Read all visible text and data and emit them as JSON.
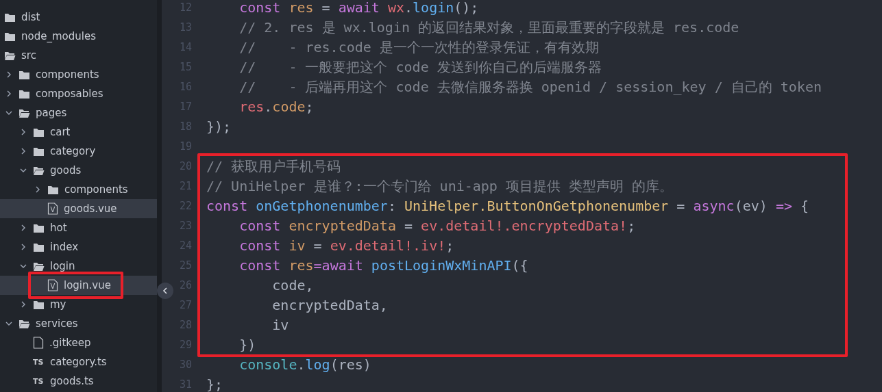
{
  "explorer": {
    "items": [
      {
        "name": "dist",
        "kind": "folder"
      },
      {
        "name": "node_modules",
        "kind": "folder"
      },
      {
        "name": "src",
        "kind": "folder",
        "children": [
          {
            "name": "components",
            "kind": "folder",
            "expanded": false,
            "selected": false
          },
          {
            "name": "composables",
            "kind": "folder",
            "expanded": false,
            "selected": false
          },
          {
            "name": "pages",
            "kind": "folder",
            "expanded": true,
            "selected": false,
            "children": [
              {
                "name": "cart",
                "kind": "folder",
                "expanded": false,
                "selected": false
              },
              {
                "name": "category",
                "kind": "folder",
                "expanded": false,
                "selected": false
              },
              {
                "name": "goods",
                "kind": "folder",
                "expanded": true,
                "selected": false,
                "children": [
                  {
                    "name": "components",
                    "kind": "folder",
                    "expanded": false,
                    "selected": false
                  },
                  {
                    "name": "goods.vue",
                    "kind": "vue",
                    "badge": "V",
                    "selected": true
                  }
                ]
              },
              {
                "name": "hot",
                "kind": "folder",
                "expanded": false,
                "selected": false
              },
              {
                "name": "index",
                "kind": "folder",
                "expanded": false,
                "selected": false
              },
              {
                "name": "login",
                "kind": "folder",
                "expanded": true,
                "selected": false,
                "children": [
                  {
                    "name": "login.vue",
                    "kind": "vue",
                    "badge": "V",
                    "selected": true,
                    "highlighted": true
                  }
                ]
              },
              {
                "name": "my",
                "kind": "folder",
                "expanded": false,
                "selected": false
              }
            ]
          },
          {
            "name": "services",
            "kind": "folder",
            "expanded": true,
            "selected": false,
            "children": [
              {
                "name": ".gitkeep",
                "kind": "file",
                "selected": false
              },
              {
                "name": "category.ts",
                "kind": "ts",
                "badge": "TS",
                "selected": false
              },
              {
                "name": "goods.ts",
                "kind": "ts",
                "badge": "TS",
                "selected": false
              }
            ]
          }
        ]
      }
    ]
  },
  "editor": {
    "blocks": [
      {
        "highlighted": false,
        "lines": [
          {
            "number": "12",
            "tokens": [
              {
                "kind": "kw",
                "t": "    const "
              },
              {
                "kind": "var",
                "t": "res"
              },
              {
                "kind": "plain",
                "t": " = "
              },
              {
                "kind": "kw",
                "t": "await "
              },
              {
                "kind": "obj",
                "t": "wx"
              },
              {
                "kind": "plain",
                "t": "."
              },
              {
                "kind": "fn",
                "t": "login"
              },
              {
                "kind": "plain",
                "t": "();"
              }
            ]
          },
          {
            "number": "13",
            "tokens": [
              {
                "kind": "comment",
                "t": "    // 2. res 是 wx.login 的返回结果对象，里面最重要的字段就是 res.code"
              }
            ]
          },
          {
            "number": "14",
            "tokens": [
              {
                "kind": "comment",
                "t": "    //    - res.code 是一个一次性的登录凭证，有有效期"
              }
            ]
          },
          {
            "number": "15",
            "tokens": [
              {
                "kind": "comment",
                "t": "    //    - 一般要把这个 code 发送到你自己的后端服务器"
              }
            ]
          },
          {
            "number": "16",
            "tokens": [
              {
                "kind": "comment",
                "t": "    //    - 后端再用这个 code 去微信服务器换 openid / session_key / 自己的 token"
              }
            ]
          },
          {
            "number": "17",
            "tokens": [
              {
                "kind": "obj",
                "t": "    res"
              },
              {
                "kind": "plain",
                "t": "."
              },
              {
                "kind": "prop",
                "t": "code"
              },
              {
                "kind": "plain",
                "t": ";"
              }
            ]
          },
          {
            "number": "18",
            "tokens": [
              {
                "kind": "plain",
                "t": "});"
              }
            ]
          },
          {
            "number": "19"
          }
        ]
      },
      {
        "highlighted": true,
        "lines": [
          {
            "number": "20",
            "tokens": [
              {
                "kind": "comment",
                "t": "// 获取用户手机号码"
              }
            ]
          },
          {
            "number": "21",
            "tokens": [
              {
                "kind": "comment",
                "t": "// UniHelper 是谁？:一个专门给 uni-app 项目提供 类型声明 的库。"
              }
            ]
          },
          {
            "number": "22",
            "tokens": [
              {
                "kind": "kw",
                "t": "const "
              },
              {
                "kind": "fn",
                "t": "onGetphonenumber"
              },
              {
                "kind": "plain",
                "t": ": "
              },
              {
                "kind": "type",
                "t": "UniHelper.ButtonOnGetphonenumber"
              },
              {
                "kind": "plain",
                "t": " = "
              },
              {
                "kind": "kw",
                "t": "async"
              },
              {
                "kind": "plain",
                "t": "(ev) "
              },
              {
                "kind": "kw",
                "t": "=>"
              },
              {
                "kind": "plain",
                "t": " {"
              }
            ]
          },
          {
            "number": "23",
            "tokens": [
              {
                "kind": "kw",
                "t": "    const "
              },
              {
                "kind": "var",
                "t": "encryptedData"
              },
              {
                "kind": "plain",
                "t": " = "
              },
              {
                "kind": "obj",
                "t": "ev.detail!.encryptedData!"
              },
              {
                "kind": "plain",
                "t": ";"
              }
            ]
          },
          {
            "number": "24",
            "tokens": [
              {
                "kind": "kw",
                "t": "    const "
              },
              {
                "kind": "var",
                "t": "iv"
              },
              {
                "kind": "plain",
                "t": " = "
              },
              {
                "kind": "obj",
                "t": "ev.detail!.iv!"
              },
              {
                "kind": "plain",
                "t": ";"
              }
            ]
          },
          {
            "number": "25",
            "tokens": [
              {
                "kind": "kw",
                "t": "    const "
              },
              {
                "kind": "var",
                "t": "res"
              },
              {
                "kind": "kw",
                "t": "=await "
              },
              {
                "kind": "fn",
                "t": "postLoginWxMinAPI"
              },
              {
                "kind": "plain",
                "t": "({"
              }
            ]
          },
          {
            "number": "26",
            "tokens": [
              {
                "kind": "plain",
                "t": "        code,"
              }
            ]
          },
          {
            "number": "27",
            "tokens": [
              {
                "kind": "plain",
                "t": "        encryptedData,"
              }
            ]
          },
          {
            "number": "28",
            "tokens": [
              {
                "kind": "plain",
                "t": "        iv"
              }
            ]
          },
          {
            "number": "29",
            "tokens": [
              {
                "kind": "plain",
                "t": "    })"
              }
            ]
          }
        ]
      },
      {
        "highlighted": false,
        "lines": [
          {
            "number": "30",
            "tokens": [
              {
                "kind": "builtin",
                "t": "    console"
              },
              {
                "kind": "plain",
                "t": "."
              },
              {
                "kind": "fn",
                "t": "log"
              },
              {
                "kind": "plain",
                "t": "(res)"
              }
            ]
          },
          {
            "number": "31",
            "tokens": [
              {
                "kind": "plain",
                "t": "};"
              }
            ]
          }
        ]
      }
    ]
  }
}
